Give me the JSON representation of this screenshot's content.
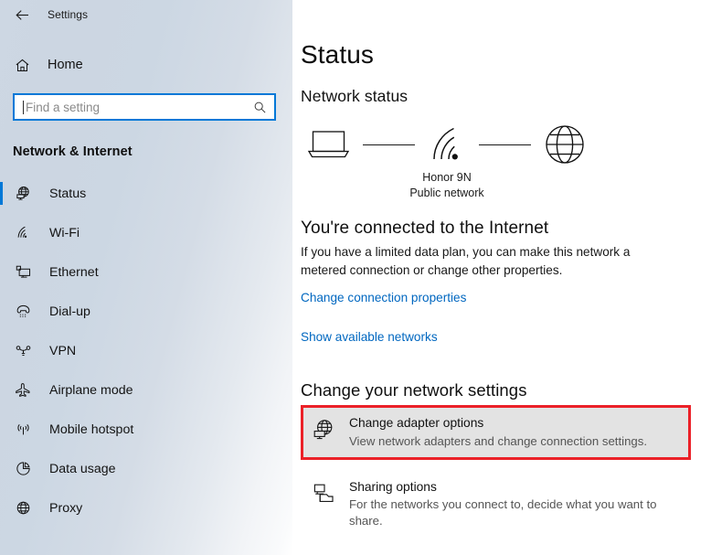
{
  "titlebar": {
    "back_icon": "back-arrow-icon",
    "title": "Settings"
  },
  "sidebar": {
    "home": {
      "icon": "home-icon",
      "label": "Home"
    },
    "search": {
      "placeholder": "Find a setting",
      "value": "",
      "icon": "search-icon"
    },
    "section_heading": "Network & Internet",
    "items": [
      {
        "label": "Status",
        "icon": "globe-monitor-icon",
        "selected": true
      },
      {
        "label": "Wi-Fi",
        "icon": "wifi-icon",
        "selected": false
      },
      {
        "label": "Ethernet",
        "icon": "ethernet-icon",
        "selected": false
      },
      {
        "label": "Dial-up",
        "icon": "dialup-phone-icon",
        "selected": false
      },
      {
        "label": "VPN",
        "icon": "vpn-icon",
        "selected": false
      },
      {
        "label": "Airplane mode",
        "icon": "airplane-icon",
        "selected": false
      },
      {
        "label": "Mobile hotspot",
        "icon": "hotspot-icon",
        "selected": false
      },
      {
        "label": "Data usage",
        "icon": "pie-chart-icon",
        "selected": false
      },
      {
        "label": "Proxy",
        "icon": "globe-icon",
        "selected": false
      }
    ]
  },
  "content": {
    "page_title": "Status",
    "network_status_heading": "Network status",
    "diagram": {
      "device_icon": "laptop-icon",
      "network_icon": "wifi-signal-icon",
      "internet_icon": "globe-icon",
      "network_name": "Honor 9N",
      "network_type": "Public network"
    },
    "connection_title": "You're connected to the Internet",
    "connection_desc": "If you have a limited data plan, you can make this network a metered connection or change other properties.",
    "link_change_connection": "Change connection properties",
    "link_show_networks": "Show available networks",
    "settings_heading": "Change your network settings",
    "options": [
      {
        "icon": "globe-monitor-icon",
        "title": "Change adapter options",
        "desc": "View network adapters and change connection settings.",
        "highlighted": true
      },
      {
        "icon": "sharing-icon",
        "title": "Sharing options",
        "desc": "For the networks you connect to, decide what you want to share.",
        "highlighted": false
      }
    ]
  },
  "colors": {
    "accent_blue": "#0078d7",
    "link_blue": "#0067c0",
    "highlight_red": "#eb2128",
    "highlight_fill": "#e3e3e3"
  }
}
